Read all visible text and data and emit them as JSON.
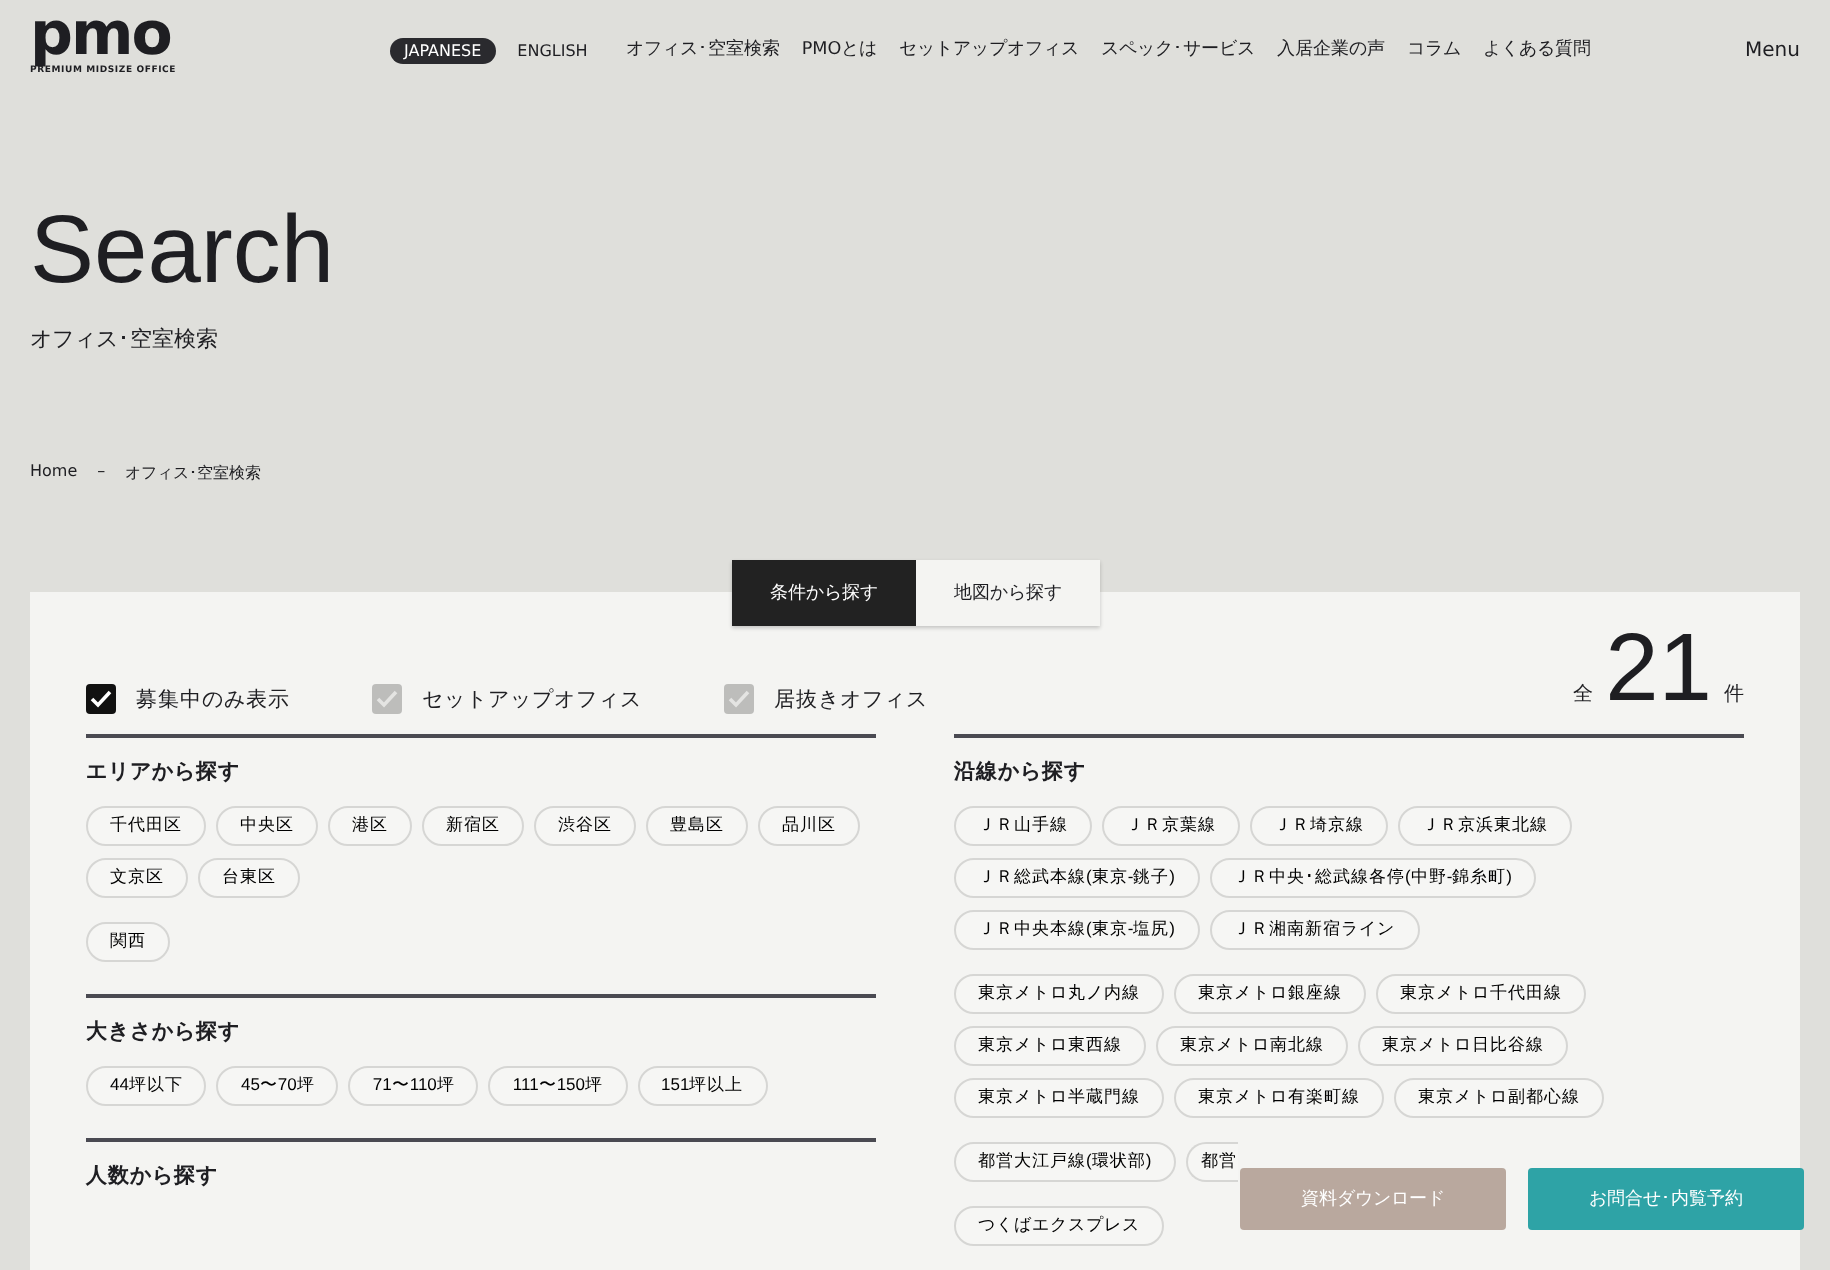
{
  "header": {
    "logo": "pmo",
    "tagline": "PREMIUM MIDSIZE OFFICE",
    "languages": [
      {
        "label": "JAPANESE",
        "selected": true
      },
      {
        "label": "ENGLISH",
        "selected": false
      }
    ],
    "nav": [
      "オフィス･空室検索",
      "PMOとは",
      "セットアップオフィス",
      "スペック･サービス",
      "入居企業の声",
      "コラム",
      "よくある質問"
    ],
    "menu": "Menu"
  },
  "hero": {
    "title": "Search",
    "subtitle": "オフィス･空室検索"
  },
  "breadcrumb": [
    "Home",
    "–",
    "オフィス･空室検索"
  ],
  "tabs": [
    {
      "label": "条件から探す",
      "selected": true
    },
    {
      "label": "地図から探す",
      "selected": false
    }
  ],
  "filters": [
    {
      "label": "募集中のみ表示",
      "checked": true
    },
    {
      "label": "セットアップオフィス",
      "checked": false
    },
    {
      "label": "居抜きオフィス",
      "checked": false
    }
  ],
  "count": {
    "prefix": "全",
    "value": "21",
    "suffix": "件"
  },
  "left_sections": [
    {
      "title": "エリアから探す",
      "groups": [
        [
          "千代田区",
          "中央区",
          "港区",
          "新宿区",
          "渋谷区",
          "豊島区",
          "品川区",
          "文京区",
          "台東区"
        ],
        [
          "関西"
        ]
      ]
    },
    {
      "title": "大きさから探す",
      "groups": [
        [
          "44坪以下",
          "45〜70坪",
          "71〜110坪",
          "111〜150坪",
          "151坪以上"
        ]
      ]
    },
    {
      "title": "人数から探す"
    }
  ],
  "right_sections": [
    {
      "title": "沿線から探す",
      "groups": [
        [
          "ＪＲ山手線",
          "ＪＲ京葉線",
          "ＪＲ埼京線",
          "ＪＲ京浜東北線",
          "ＪＲ総武本線(東京-銚子)",
          "ＪＲ中央･総武線各停(中野-錦糸町)",
          "ＪＲ中央本線(東京-塩尻)",
          "ＪＲ湘南新宿ライン"
        ],
        [
          "東京メトロ丸ノ内線",
          "東京メトロ銀座線",
          "東京メトロ千代田線",
          "東京メトロ東西線",
          "東京メトロ南北線",
          "東京メトロ日比谷線",
          "東京メトロ半蔵門線",
          "東京メトロ有楽町線",
          "東京メトロ副都心線"
        ],
        [
          "都営大江戸線(環状部)",
          {
            "label": "都営",
            "cut": true
          }
        ],
        [
          "つくばエクスプレス"
        ]
      ]
    }
  ],
  "floating_buttons": [
    {
      "label": "資料ダウンロード",
      "kind": "download"
    },
    {
      "label": "お問合せ･内覧予約",
      "kind": "contact"
    }
  ]
}
